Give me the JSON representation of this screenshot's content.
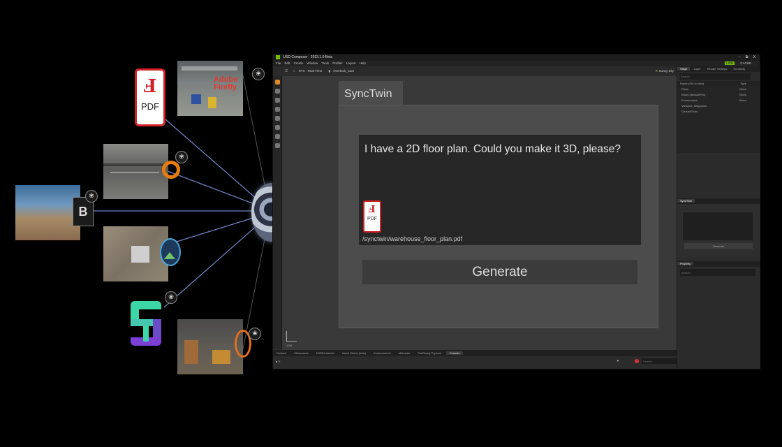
{
  "collage": {
    "pdf_label": "PDF",
    "firefly_label": "Adobe Firefly",
    "left_logo_letter": "B"
  },
  "app": {
    "title": "USD Composer",
    "version": "2023.1.0-Beta",
    "window_controls": [
      "–",
      "⧉",
      "X"
    ],
    "menu": [
      "File",
      "Edit",
      "Create",
      "Window",
      "Tools",
      "Profiler",
      "Layout",
      "Help"
    ],
    "live_label": "LIVE",
    "cache_label": "CACHE",
    "toolbar": {
      "renderer": "RTX - Real-Time",
      "camera": "Overlook_Cam",
      "sky": "Sunny Sky"
    },
    "stage": {
      "tabs": [
        "Stage",
        "Layer",
        "Render Settings",
        "Sunstudy"
      ],
      "search_placeholder": "Search",
      "columns": [
        "Name (Old to New)",
        "Type"
      ],
      "rows": [
        {
          "name": "Plane",
          "type": "Mesh"
        },
        {
          "name": "World (defaultPrim)",
          "type": "Xform"
        },
        {
          "name": "Environment",
          "type": "Xform"
        },
        {
          "name": "Viewport_Waypoints",
          "type": ""
        },
        {
          "name": "GeolaniTools",
          "type": ""
        }
      ]
    },
    "synctwin_mini": {
      "tab": "SyncTwin",
      "button": "Generate"
    },
    "property": {
      "tab": "Property",
      "search_placeholder": "Search"
    },
    "bottom_tabs": [
      "Content",
      "Showcases",
      "NVIDIA Assets",
      "Asset Stores (beta)",
      "Environments",
      "Materials",
      "SimReady Explorer",
      "Console"
    ],
    "console_search": "Search",
    "axis_label": "10M"
  },
  "synctwin": {
    "tab_title": "SyncTwin",
    "prompt": "I have a 2D floor plan. Could you make it 3D, please?",
    "attachment_label": "PDF",
    "attachment_path": "/synctwin/warehouse_floor_plan.pdf",
    "generate_label": "Generate"
  },
  "colors": {
    "pdf_red": "#d42127",
    "app_bg": "#2b2b2b",
    "panel_bg": "#4c4c4c",
    "accent_green": "#8fc31f"
  }
}
